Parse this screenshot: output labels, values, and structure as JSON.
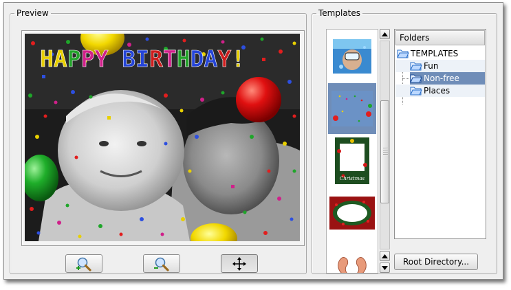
{
  "preview": {
    "group_title": "Preview",
    "image_caption": "HAPPY BIRTHDAY!",
    "caption_colors": [
      "#e8d000",
      "#e8d000",
      "#23a32a",
      "#d0208a",
      "#d0208a",
      "#2545d8",
      "#2545d8",
      "#cc1d1d",
      "#d0208a",
      "#23a32a",
      "#2545d8",
      "#2545d8",
      "#cc1d1d",
      "#e8d000",
      "#23a32a"
    ],
    "buttons": [
      {
        "name": "zoom-in",
        "icon": "magnifier-plus-icon"
      },
      {
        "name": "zoom-out",
        "icon": "magnifier-minus-icon"
      },
      {
        "name": "pan",
        "icon": "move-arrows-icon",
        "pressed": true
      }
    ]
  },
  "templates": {
    "group_title": "Templates",
    "thumbnails": [
      {
        "name": "underwater-diver",
        "selected": false
      },
      {
        "name": "blue-confetti",
        "selected": true
      },
      {
        "name": "christmas-frame",
        "selected": false,
        "text": "Christmas"
      },
      {
        "name": "holly-wreath",
        "selected": false
      },
      {
        "name": "ears",
        "selected": false
      }
    ],
    "tree": {
      "header": "Folders",
      "items": [
        {
          "label": "TEMPLATES",
          "icon": "folder-open-icon",
          "level": 0
        },
        {
          "label": "Fun",
          "icon": "folder-open-icon",
          "level": 1
        },
        {
          "label": "Non-free",
          "icon": "folder-open-icon",
          "level": 1,
          "selected": true
        },
        {
          "label": "Places",
          "icon": "folder-open-icon",
          "level": 1
        }
      ]
    },
    "root_directory_label": "Root Directory..."
  },
  "colors": {
    "selection": "#6f8db8",
    "folder": "#3b7fd6",
    "window_bg": "#efefef"
  }
}
